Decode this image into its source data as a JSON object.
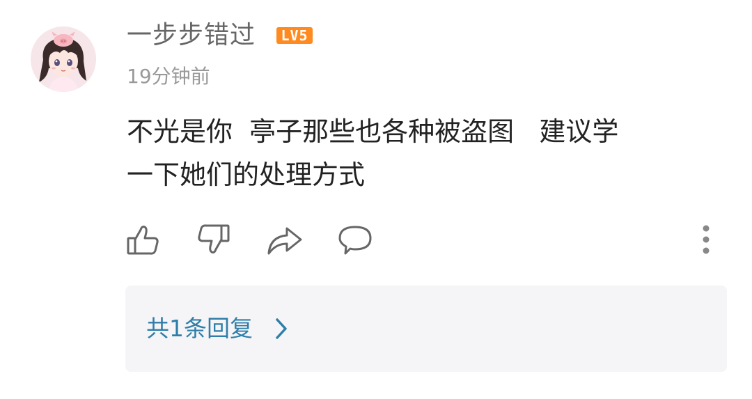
{
  "comment": {
    "author": "一步步错过",
    "level_badge": "LV5",
    "time": "19分钟前",
    "content_lines": [
      "不光是你  亭子那些也各种被盗图   建议学",
      "一下她们的处理方式"
    ]
  },
  "actions": {
    "icons": [
      "thumbs-up-icon",
      "thumbs-down-icon",
      "share-icon",
      "comment-icon",
      "more-icon"
    ]
  },
  "replies": {
    "label": "共1条回复",
    "icon": "chevron-right-icon"
  },
  "colors": {
    "level_badge": "#ff8a1f",
    "reply_link": "#2f7ea9",
    "reply_bg": "#f5f5f7"
  }
}
